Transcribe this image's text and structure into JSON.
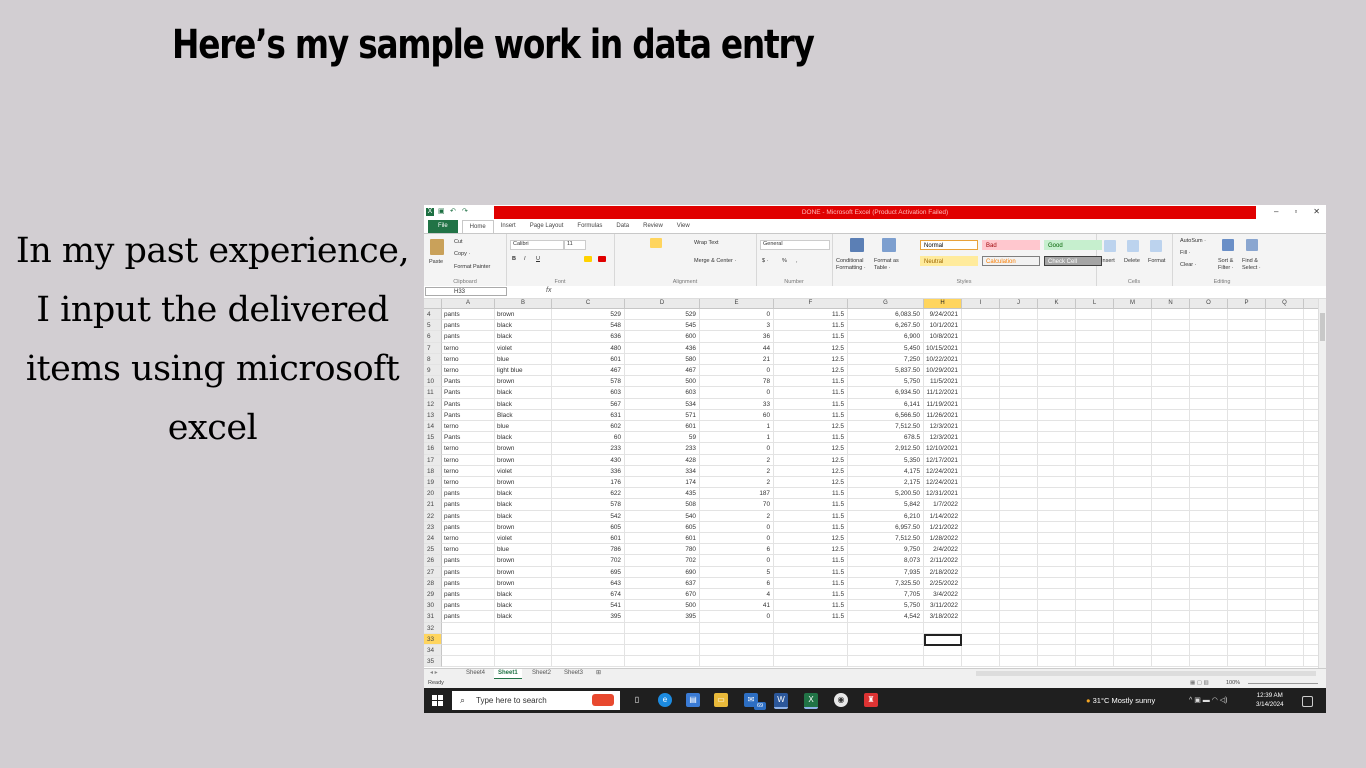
{
  "slide": {
    "title": "Here’s my sample work in data entry",
    "description_lines": [
      "In my past experience,",
      "I  input the delivered",
      "items using microsoft",
      "excel"
    ]
  },
  "excel": {
    "window_title": "DONE - Microsoft Excel (Product Activation Failed)",
    "window_controls": {
      "minimize": "–",
      "restore": "▫",
      "close": "✕"
    },
    "tabs": [
      "File",
      "Home",
      "Insert",
      "Page Layout",
      "Formulas",
      "Data",
      "Review",
      "View"
    ],
    "active_tab": "Home",
    "ribbon": {
      "clipboard": {
        "paste": "Paste",
        "cut": "Cut",
        "copy": "Copy ·",
        "format_painter": "Format Painter",
        "label": "Clipboard"
      },
      "font": {
        "name": "Calibri",
        "size": "11",
        "bold": "B",
        "italic": "I",
        "underline": "U",
        "label": "Font"
      },
      "alignment": {
        "wrap": "Wrap Text",
        "merge": "Merge & Center ·",
        "label": "Alignment"
      },
      "number": {
        "format": "General",
        "currency": "$ ·",
        "percent": "%",
        "comma": ",",
        "label": "Number"
      },
      "styles": {
        "conditional": "Conditional Formatting ·",
        "format_as_table": "Format as Table ·",
        "label": "Styles",
        "boxes": [
          {
            "text": "Normal",
            "bg": "#ffffff",
            "fg": "#000000",
            "border": "#e8a23a"
          },
          {
            "text": "Bad",
            "bg": "#ffc7ce",
            "fg": "#9c0006",
            "border": "#ffc7ce"
          },
          {
            "text": "Good",
            "bg": "#c6efce",
            "fg": "#006100",
            "border": "#c6efce"
          },
          {
            "text": "Neutral",
            "bg": "#ffeb9c",
            "fg": "#9c6500",
            "border": "#ffeb9c"
          },
          {
            "text": "Calculation",
            "bg": "#f2f2f2",
            "fg": "#fa7d00",
            "border": "#7f7f7f"
          },
          {
            "text": "Check Cell",
            "bg": "#a5a5a5",
            "fg": "#ffffff",
            "border": "#3f3f3f"
          }
        ]
      },
      "cells": {
        "insert": "Insert",
        "delete": "Delete",
        "format": "Format",
        "label": "Cells"
      },
      "editing": {
        "autosum": "AutoSum ·",
        "fill": "Fill ·",
        "clear": "Clear ·",
        "sort": "Sort & Filter ·",
        "find": "Find & Select ·",
        "label": "Editing"
      }
    },
    "name_box": "H33",
    "fx": "fx",
    "columns": [
      "A",
      "B",
      "C",
      "D",
      "E",
      "F",
      "G",
      "H",
      "I",
      "J",
      "K",
      "L",
      "M",
      "N",
      "O",
      "P",
      "Q",
      "R"
    ],
    "selected_column": "H",
    "selected_row": "33",
    "rows": [
      [
        "4",
        "pants",
        "brown",
        "529",
        "529",
        "0",
        "11.5",
        "6,083.50",
        "9/24/2021"
      ],
      [
        "5",
        "pants",
        "black",
        "548",
        "545",
        "3",
        "11.5",
        "6,267.50",
        "10/1/2021"
      ],
      [
        "6",
        "pants",
        "black",
        "636",
        "600",
        "36",
        "11.5",
        "6,900",
        "10/8/2021"
      ],
      [
        "7",
        "terno",
        "violet",
        "480",
        "436",
        "44",
        "12.5",
        "5,450",
        "10/15/2021"
      ],
      [
        "8",
        "terno",
        "blue",
        "601",
        "580",
        "21",
        "12.5",
        "7,250",
        "10/22/2021"
      ],
      [
        "9",
        "terno",
        "light blue",
        "467",
        "467",
        "0",
        "12.5",
        "5,837.50",
        "10/29/2021"
      ],
      [
        "10",
        "Pants",
        "brown",
        "578",
        "500",
        "78",
        "11.5",
        "5,750",
        "11/5/2021"
      ],
      [
        "11",
        "Pants",
        "black",
        "603",
        "603",
        "0",
        "11.5",
        "6,934.50",
        "11/12/2021"
      ],
      [
        "12",
        "Pants",
        "black",
        "567",
        "534",
        "33",
        "11.5",
        "6,141",
        "11/19/2021"
      ],
      [
        "13",
        "Pants",
        " Black",
        "631",
        "571",
        "60",
        "11.5",
        "6,566.50",
        "11/26/2021"
      ],
      [
        "14",
        "terno",
        "blue",
        "602",
        "601",
        "1",
        "12.5",
        "7,512.50",
        "12/3/2021"
      ],
      [
        "15",
        "Pants",
        "black",
        "60",
        "59",
        "1",
        "11.5",
        "678.5",
        "12/3/2021"
      ],
      [
        "16",
        "terno",
        "brown",
        "233",
        "233",
        "0",
        "12.5",
        "2,912.50",
        "12/10/2021"
      ],
      [
        "17",
        "terno",
        "brown",
        "430",
        "428",
        "2",
        "12.5",
        "5,350",
        "12/17/2021"
      ],
      [
        "18",
        "terno",
        "violet",
        "336",
        "334",
        "2",
        "12.5",
        "4,175",
        "12/24/2021"
      ],
      [
        "19",
        "terno",
        "brown",
        "176",
        "174",
        "2",
        "12.5",
        "2,175",
        "12/24/2021"
      ],
      [
        "20",
        "pants",
        "black",
        "622",
        "435",
        "187",
        "11.5",
        "5,200.50",
        "12/31/2021"
      ],
      [
        "21",
        "pants",
        "black",
        "578",
        "508",
        "70",
        "11.5",
        "5,842",
        "1/7/2022"
      ],
      [
        "22",
        "pants",
        "black",
        "542",
        "540",
        "2",
        "11.5",
        "6,210",
        "1/14/2022"
      ],
      [
        "23",
        "pants",
        "brown",
        "605",
        "605",
        "0",
        "11.5",
        "6,957.50",
        "1/21/2022"
      ],
      [
        "24",
        "terno",
        "violet",
        "601",
        "601",
        "0",
        "12.5",
        "7,512.50",
        "1/28/2022"
      ],
      [
        "25",
        "terno",
        "blue",
        "786",
        "780",
        "6",
        "12.5",
        "9,750",
        "2/4/2022"
      ],
      [
        "26",
        "pants",
        "brown",
        "702",
        "702",
        "0",
        "11.5",
        "8,073",
        "2/11/2022"
      ],
      [
        "27",
        "pants",
        "brown",
        "695",
        "690",
        "5",
        "11.5",
        "7,935",
        "2/18/2022"
      ],
      [
        "28",
        "pants",
        "brown",
        "643",
        "637",
        "6",
        "11.5",
        "7,325.50",
        "2/25/2022"
      ],
      [
        "29",
        "pants",
        "black",
        "674",
        "670",
        "4",
        "11.5",
        "7,705",
        "3/4/2022"
      ],
      [
        "30",
        "pants",
        "black",
        "541",
        "500",
        "41",
        "11.5",
        "5,750",
        "3/11/2022"
      ],
      [
        "31",
        "pants",
        "black",
        "395",
        "395",
        "0",
        "11.5",
        "4,542",
        "3/18/2022"
      ],
      [
        "32",
        "",
        "",
        "",
        "",
        "",
        "",
        "",
        ""
      ],
      [
        "33",
        "",
        "",
        "",
        "",
        "",
        "",
        "",
        ""
      ],
      [
        "34",
        "",
        "",
        "",
        "",
        "",
        "",
        "",
        ""
      ],
      [
        "35",
        "",
        "",
        "",
        "",
        "",
        "",
        "",
        ""
      ]
    ],
    "sheets": [
      "Sheet4",
      "Sheet1",
      "Sheet2",
      "Sheet3"
    ],
    "active_sheet": "Sheet1",
    "status": "Ready",
    "zoom": "100%"
  },
  "taskbar": {
    "search_placeholder": "Type here to search",
    "badge": "69",
    "weather": "31°C  Mostly sunny",
    "time": "12:39 AM",
    "date": "3/14/2024",
    "accent": "#1f1f1f"
  }
}
